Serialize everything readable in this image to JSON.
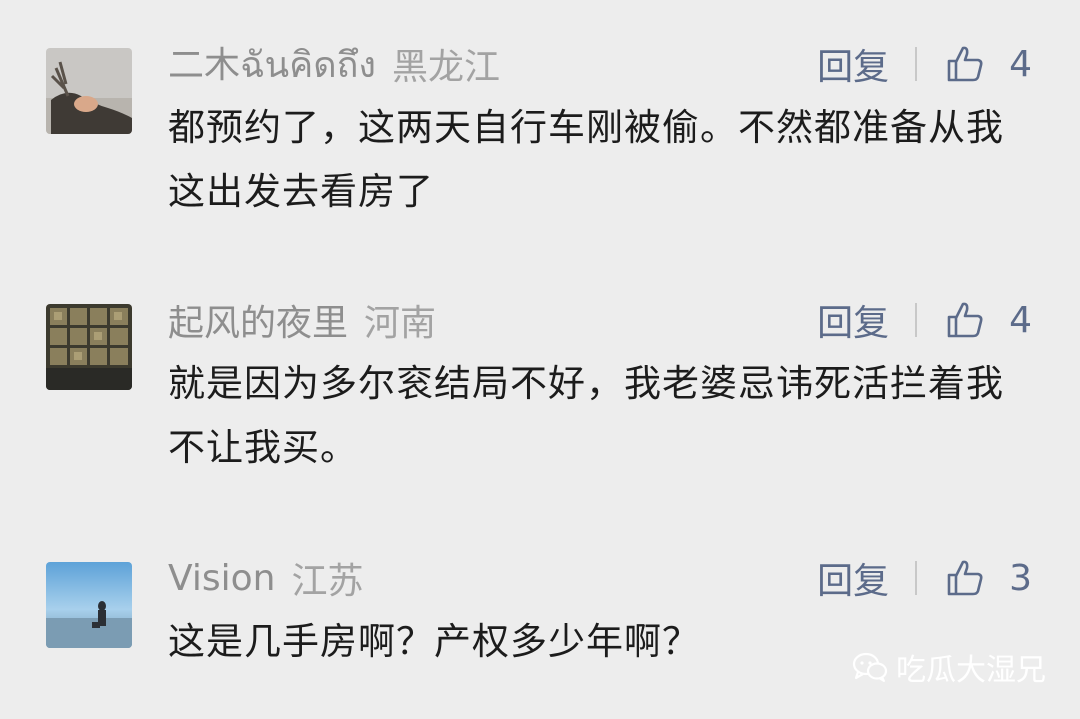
{
  "comments": [
    {
      "name": "二木ฉันคิดถึง",
      "location": "黑龙江",
      "reply_label": "回复",
      "likes": "4",
      "text": "都预约了，这两天自行车刚被偷。不然都准备从我这出发去看房了"
    },
    {
      "name": "起风的夜里",
      "location": "河南",
      "reply_label": "回复",
      "likes": "4",
      "text": "就是因为多尔衮结局不好，我老婆忌讳死活拦着我不让我买。"
    },
    {
      "name": "Vision",
      "location": "江苏",
      "reply_label": "回复",
      "likes": "3",
      "text": "这是几手房啊？产权多少年啊？"
    }
  ],
  "watermark": {
    "text": "吃瓜大湿兄",
    "icon": "wechat-icon"
  },
  "colors": {
    "background": "#ededed",
    "name": "#8e8e8e",
    "action": "#5c6b8a",
    "text": "#1c1c1c"
  }
}
